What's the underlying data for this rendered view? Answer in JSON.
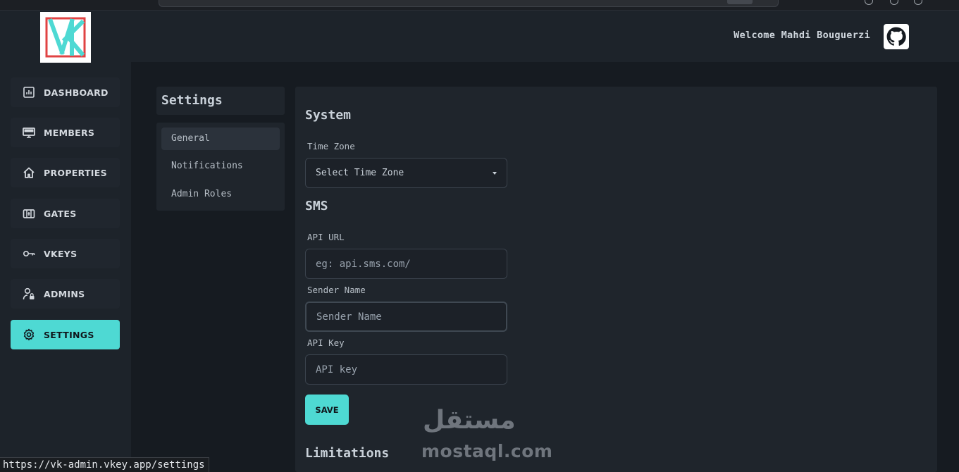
{
  "header": {
    "welcome_text": "Welcome Mahdi Bouguerzi",
    "github_icon": "github-icon"
  },
  "sidebar": {
    "logo_icon": "vk-logo",
    "items": [
      {
        "label": "DASHBOARD",
        "icon": "bar-chart-icon",
        "active": false
      },
      {
        "label": "MEMBERS",
        "icon": "monitor-icon",
        "active": false
      },
      {
        "label": "PROPERTIES",
        "icon": "home-icon",
        "active": false
      },
      {
        "label": "GATES",
        "icon": "gate-icon",
        "active": false
      },
      {
        "label": "VKEYS",
        "icon": "key-icon",
        "active": false
      },
      {
        "label": "ADMINS",
        "icon": "user-lock-icon",
        "active": false
      },
      {
        "label": "SETTINGS",
        "icon": "gear-icon",
        "active": true
      }
    ]
  },
  "settings_nav": {
    "title": "Settings",
    "items": [
      {
        "label": "General",
        "active": true
      },
      {
        "label": "Notifications",
        "active": false
      },
      {
        "label": "Admin Roles",
        "active": false
      }
    ]
  },
  "form": {
    "system_title": "System",
    "timezone_label": "Time Zone",
    "timezone_value": "Select Time Zone",
    "sms_title": "SMS",
    "api_url_label": "API URL",
    "api_url_placeholder": "eg: api.sms.com/",
    "sender_name_label": "Sender Name",
    "sender_name_placeholder": "Sender Name",
    "api_key_label": "API Key",
    "api_key_placeholder": "API key",
    "save_label": "SAVE",
    "limitations_title": "Limitations"
  },
  "watermark": {
    "arabic": "مستقل",
    "latin": "mostaql.com"
  },
  "status_bar": {
    "url": "https://vk-admin.vkey.app/settings"
  },
  "colors": {
    "accent": "#4ed9d3",
    "background": "#161b21",
    "panel": "#1f252c"
  }
}
